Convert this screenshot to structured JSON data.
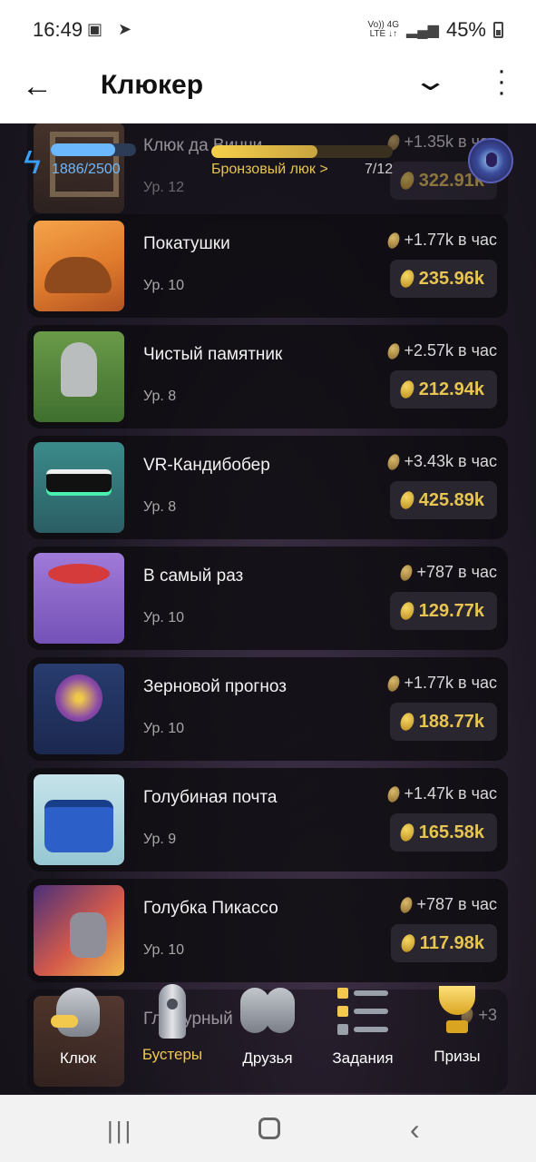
{
  "status_bar": {
    "time": "16:49",
    "net_top": "Vo)) 4G",
    "net_bottom": "LTE ↓↑",
    "battery": "45%"
  },
  "app_bar": {
    "title": "Клюкер"
  },
  "hud": {
    "energy_text": "1886/2500",
    "energy_fraction": 0.7544,
    "level_label": "Бронзовый люк >",
    "level_count": "7/12",
    "level_fraction": 0.583
  },
  "cards": [
    {
      "name": "Клюк да Винчи",
      "level": "Ур. 12",
      "rate": "+1.35k в час",
      "price": "322.91k"
    },
    {
      "name": "Покатушки",
      "level": "Ур. 10",
      "rate": "+1.77k в час",
      "price": "235.96k"
    },
    {
      "name": "Чистый памятник",
      "level": "Ур. 8",
      "rate": "+2.57k в час",
      "price": "212.94k"
    },
    {
      "name": "VR-Кандибобер",
      "level": "Ур. 8",
      "rate": "+3.43k в час",
      "price": "425.89k"
    },
    {
      "name": "В самый раз",
      "level": "Ур. 10",
      "rate": "+787 в час",
      "price": "129.77k"
    },
    {
      "name": "Зерновой прогноз",
      "level": "Ур. 10",
      "rate": "+1.77k в час",
      "price": "188.77k"
    },
    {
      "name": "Голубиная почта",
      "level": "Ур. 9",
      "rate": "+1.47k в час",
      "price": "165.58k"
    },
    {
      "name": "Голубка Пикассо",
      "level": "Ур. 10",
      "rate": "+787 в час",
      "price": "117.98k"
    },
    {
      "name": "Гламурный",
      "level": "",
      "rate": "+3",
      "price": ""
    }
  ],
  "bottom_nav": {
    "items": [
      {
        "label": "Клюк"
      },
      {
        "label": "Бустеры"
      },
      {
        "label": "Друзья"
      },
      {
        "label": "Задания"
      },
      {
        "label": "Призы"
      }
    ],
    "active_color": "#f2c94c"
  }
}
